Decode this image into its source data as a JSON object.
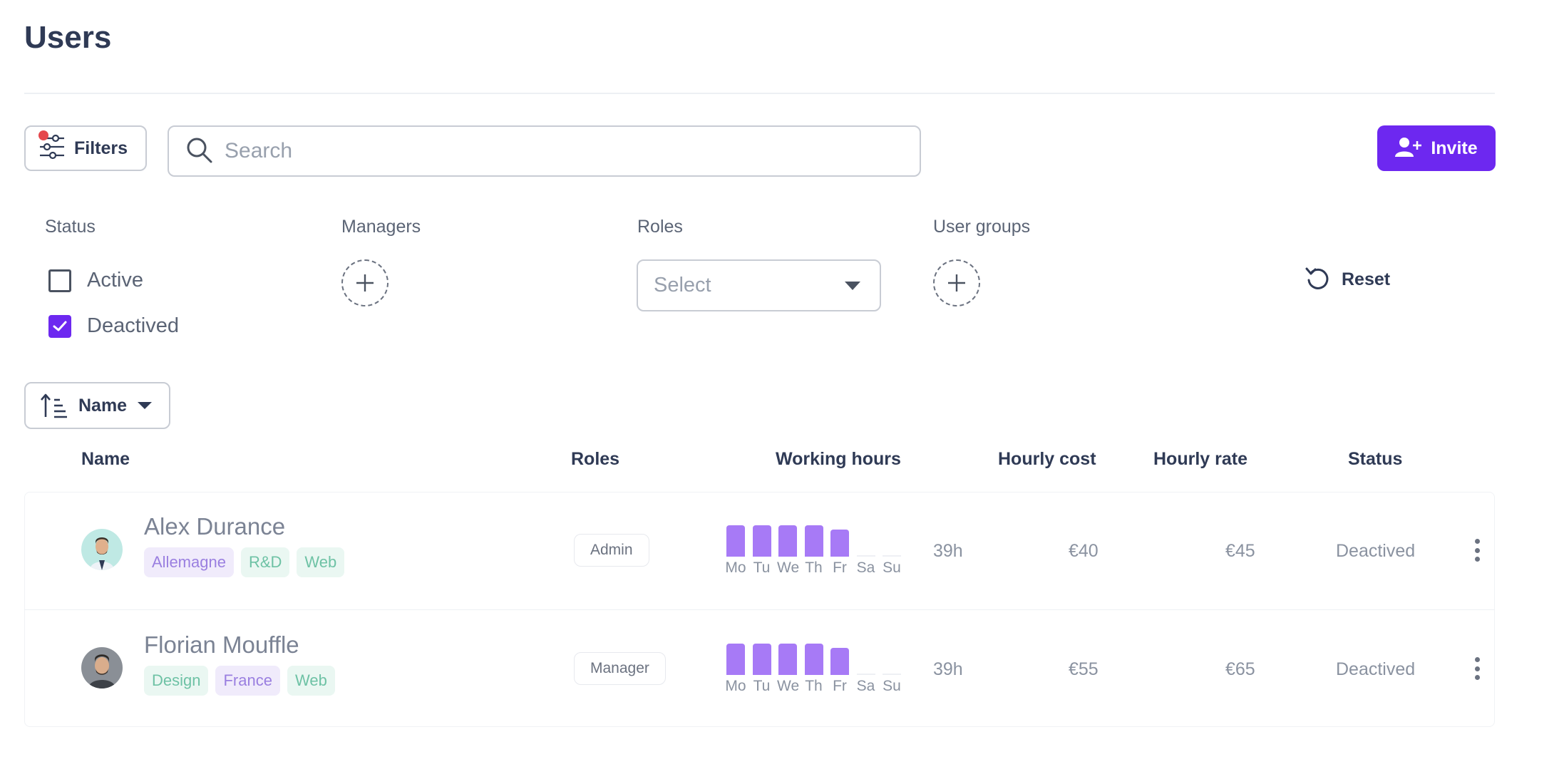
{
  "page": {
    "title": "Users"
  },
  "toolbar": {
    "filters_label": "Filters",
    "search_placeholder": "Search",
    "invite_label": "Invite",
    "filters_indicator_color": "#e5484d",
    "accent_color": "#6d28f0"
  },
  "filters": {
    "status": {
      "label": "Status",
      "options": [
        {
          "label": "Active",
          "checked": false
        },
        {
          "label": "Deactived",
          "checked": true
        }
      ]
    },
    "managers": {
      "label": "Managers"
    },
    "roles": {
      "label": "Roles",
      "placeholder": "Select"
    },
    "user_groups": {
      "label": "User groups"
    },
    "reset_label": "Reset"
  },
  "sort": {
    "label": "Name"
  },
  "table": {
    "headers": [
      "Name",
      "Roles",
      "Working hours",
      "Hourly cost",
      "Hourly rate",
      "Status"
    ],
    "days": [
      "Mo",
      "Tu",
      "We",
      "Th",
      "Fr",
      "Sa",
      "Su"
    ],
    "rows": [
      {
        "name": "Alex Durance",
        "tags": [
          {
            "label": "Allemagne",
            "color": "purple"
          },
          {
            "label": "R&D",
            "color": "green"
          },
          {
            "label": "Web",
            "color": "green"
          }
        ],
        "role": "Admin",
        "daily_hours": [
          8,
          8,
          8,
          8,
          7,
          0,
          0
        ],
        "total_hours": "39h",
        "hourly_cost": "€40",
        "hourly_rate": "€45",
        "status": "Deactived"
      },
      {
        "name": "Florian Mouffle",
        "tags": [
          {
            "label": "Design",
            "color": "green"
          },
          {
            "label": "France",
            "color": "purple"
          },
          {
            "label": "Web",
            "color": "green"
          }
        ],
        "role": "Manager",
        "daily_hours": [
          8,
          8,
          8,
          8,
          7,
          0,
          0
        ],
        "total_hours": "39h",
        "hourly_cost": "€55",
        "hourly_rate": "€65",
        "status": "Deactived"
      }
    ]
  }
}
